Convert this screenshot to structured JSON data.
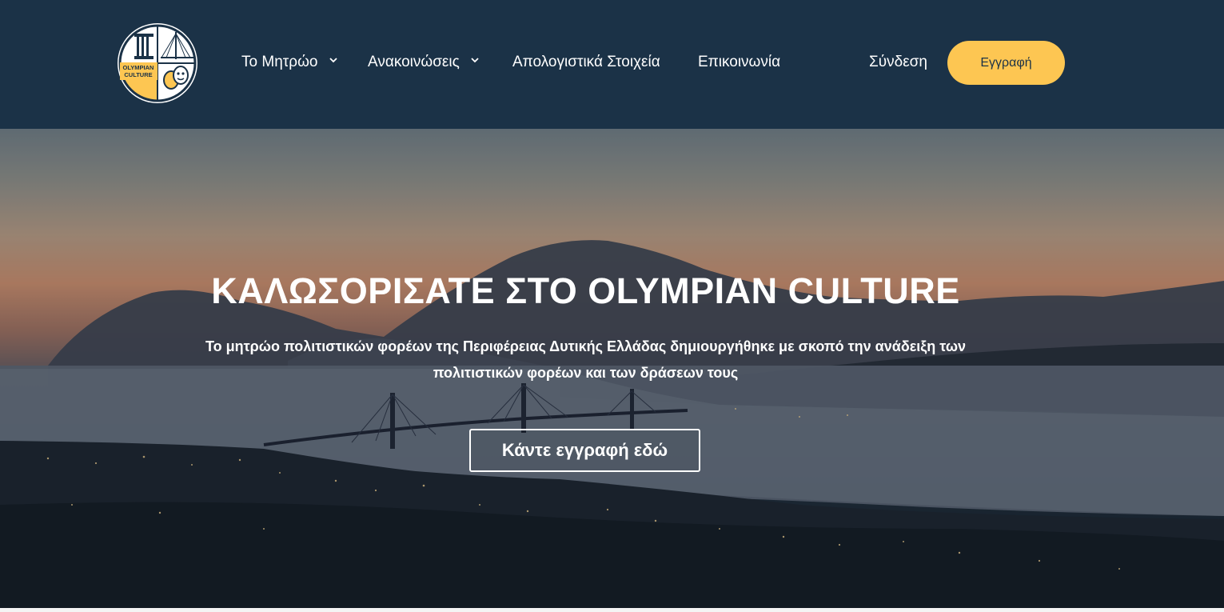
{
  "brand": {
    "logo_line1": "OLYMPIAN",
    "logo_line2": "CULTURE",
    "colors": {
      "navy": "#1b3247",
      "accent": "#fdc652",
      "white": "#ffffff"
    }
  },
  "nav": {
    "items": [
      {
        "label": "Το Μητρώο",
        "icon": "chevron-down-icon"
      },
      {
        "label": "Ανακοινώσεις",
        "icon": "chevron-down-icon"
      },
      {
        "label": "Απολογιστικά Στοιχεία"
      },
      {
        "label": "Επικοινωνία"
      }
    ],
    "login_label": "Σύνδεση",
    "register_label": "Εγγραφή"
  },
  "hero": {
    "title": "ΚΑΛΩΣΟΡΙΣΑΤΕ ΣΤΟ OLYMPIAN CULTURE",
    "subtitle": "Το μητρώο πολιτιστικών φορέων της Περιφέρειας Δυτικής Ελλάδας δημιουργήθηκε με σκοπό την ανάδειξη των πολιτιστικών φορέων και των δράσεων τους",
    "cta_label": "Κάντε εγγραφή εδώ"
  }
}
